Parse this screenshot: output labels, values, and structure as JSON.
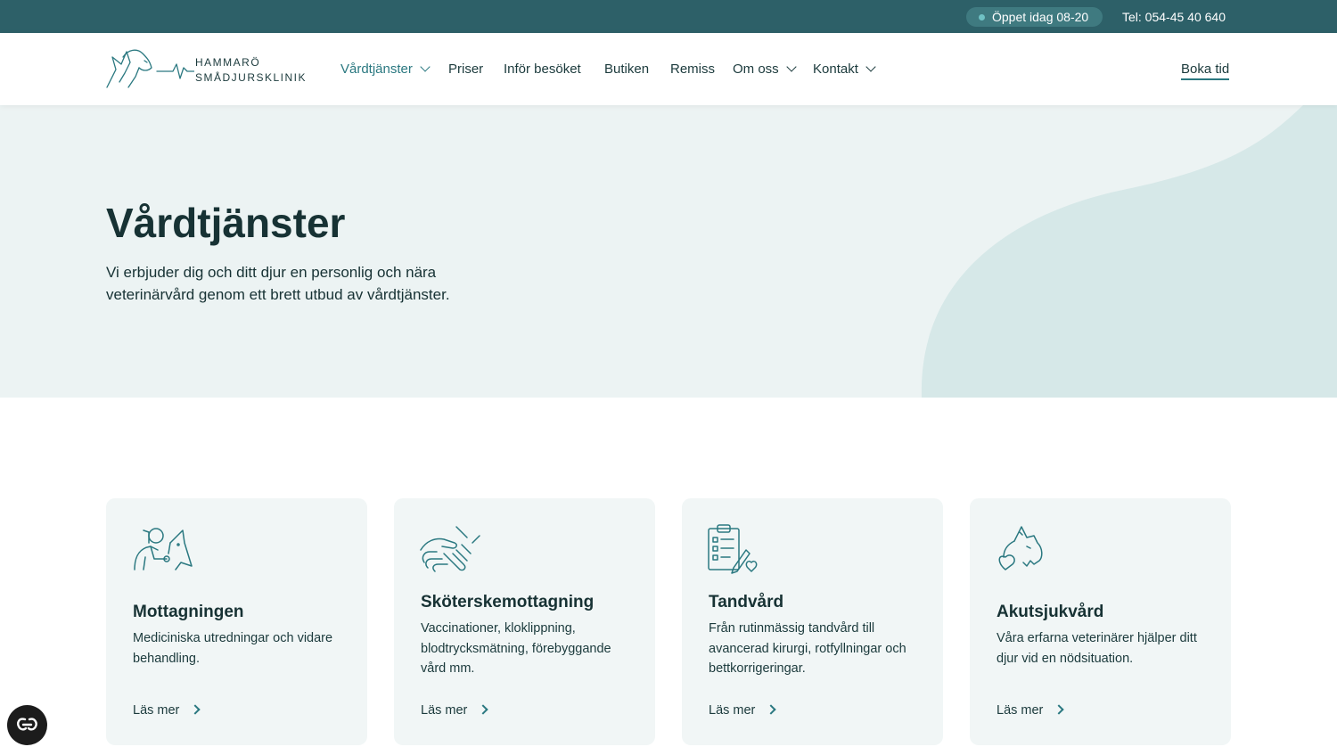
{
  "topbar": {
    "open_status": "Öppet idag 08-20",
    "phone": "Tel: 054-45 40 640",
    "status_dot_color": "#6fc1c4"
  },
  "header": {
    "logo": {
      "line1": "HAMMARÖ",
      "line2": "SMÅDJURSKLINIK"
    },
    "nav": [
      {
        "label": "Vårdtjänster",
        "dropdown": true,
        "active": true
      },
      {
        "label": "Priser",
        "dropdown": false
      },
      {
        "label": "Inför besöket",
        "dropdown": false
      },
      {
        "label": "Butiken",
        "dropdown": false
      },
      {
        "label": "Remiss",
        "dropdown": false
      },
      {
        "label": "Om oss",
        "dropdown": true
      },
      {
        "label": "Kontakt",
        "dropdown": true
      }
    ],
    "book_label": "Boka tid"
  },
  "hero": {
    "title": "Vårdtjänster",
    "text": "Vi erbjuder dig och ditt djur en personlig och nära veterinärvård genom ett brett utbud av vårdtjänster."
  },
  "cards": [
    {
      "icon": "vet-stethoscope-dog-icon",
      "title": "Mottagningen",
      "description": "Mediciniska utredningar och vidare behandling.",
      "link": "Läs mer"
    },
    {
      "icon": "caring-hands-icon",
      "title": "Sköterskemottagning",
      "description": "Vaccinationer, kloklippning, blodtrycksmätning, förebyggande vård mm.",
      "link": "Läs mer"
    },
    {
      "icon": "checklist-clipboard-icon",
      "title": "Tandvård",
      "description": "Från rutinmässig tandvård till avancerad kirurgi, rotfyllningar och bettkorrigeringar.",
      "link": "Läs mer"
    },
    {
      "icon": "cat-heart-icon",
      "title": "Akutsjukvård",
      "description": "Våra erfarna veterinärer hjälper ditt djur vid en nödsituation.",
      "link": "Läs mer"
    }
  ],
  "colors": {
    "topbar": "#2d6068",
    "accent": "#2a7880",
    "hero_bg": "#ecf3f3",
    "card_bg": "#f1f6f6"
  }
}
